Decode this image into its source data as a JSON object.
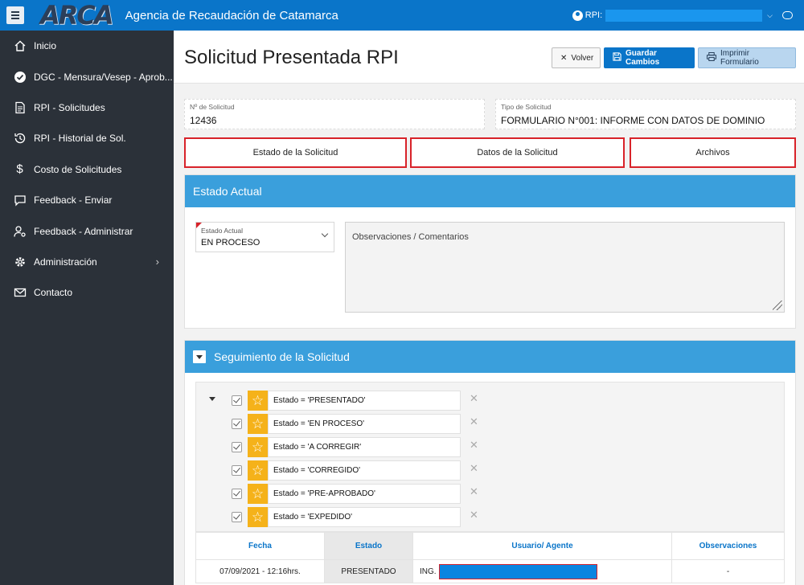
{
  "topbar": {
    "logo": "ARCA",
    "agency": "Agencia de Recaudación de Catamarca",
    "user_label": "RPI:"
  },
  "sidebar": {
    "items": [
      {
        "label": "Inicio",
        "icon": "home-icon"
      },
      {
        "label": "DGC - Mensura/Vesep - Aprob...",
        "icon": "check-circle-icon"
      },
      {
        "label": "RPI - Solicitudes",
        "icon": "document-icon"
      },
      {
        "label": "RPI - Historial de Sol.",
        "icon": "history-icon"
      },
      {
        "label": "Costo de Solicitudes",
        "icon": "dollar-icon"
      },
      {
        "label": "Feedback - Enviar",
        "icon": "comment-icon"
      },
      {
        "label": "Feedback - Administrar",
        "icon": "user-gear-icon"
      },
      {
        "label": "Administración",
        "icon": "gear-icon",
        "has_submenu": true
      },
      {
        "label": "Contacto",
        "icon": "mail-icon"
      }
    ]
  },
  "page": {
    "title": "Solicitud Presentada RPI",
    "buttons": {
      "volver": "Volver",
      "guardar": "Guardar Cambios",
      "imprimir": "Imprimir Formulario"
    }
  },
  "fields": {
    "nro_label": "Nº de Solicitud",
    "nro_value": "12436",
    "tipo_label": "Tipo de Solicitud",
    "tipo_value": "FORMULARIO N°001: INFORME CON DATOS DE DOMINIO"
  },
  "tabs": [
    "Estado de la Solicitud",
    "Datos de la Solicitud",
    "Archivos"
  ],
  "estado_panel": {
    "title": "Estado Actual",
    "select_label": "Estado Actual",
    "select_value": "EN PROCESO",
    "textarea_placeholder": "Observaciones / Comentarios"
  },
  "seguimiento": {
    "title": "Seguimiento de la Solicitud",
    "filters": [
      "Estado = 'PRESENTADO'",
      "Estado = 'EN PROCESO'",
      "Estado = 'A CORREGIR'",
      "Estado = 'CORREGIDO'",
      "Estado = 'PRE-APROBADO'",
      "Estado = 'EXPEDIDO'"
    ],
    "columns": [
      "Fecha",
      "Estado",
      "Usuario/ Agente",
      "Observaciones"
    ],
    "rows": [
      {
        "fecha": "07/09/2021 - 12:16hrs.",
        "estado": "PRESENTADO",
        "usuario": "ING.",
        "obs": "-"
      }
    ]
  },
  "colors": {
    "topbar": "#0a75c9",
    "sidebar": "#2b3139",
    "panel_header": "#3a9fdc",
    "star": "#f5b21a",
    "highlight_border": "#d8232a"
  }
}
